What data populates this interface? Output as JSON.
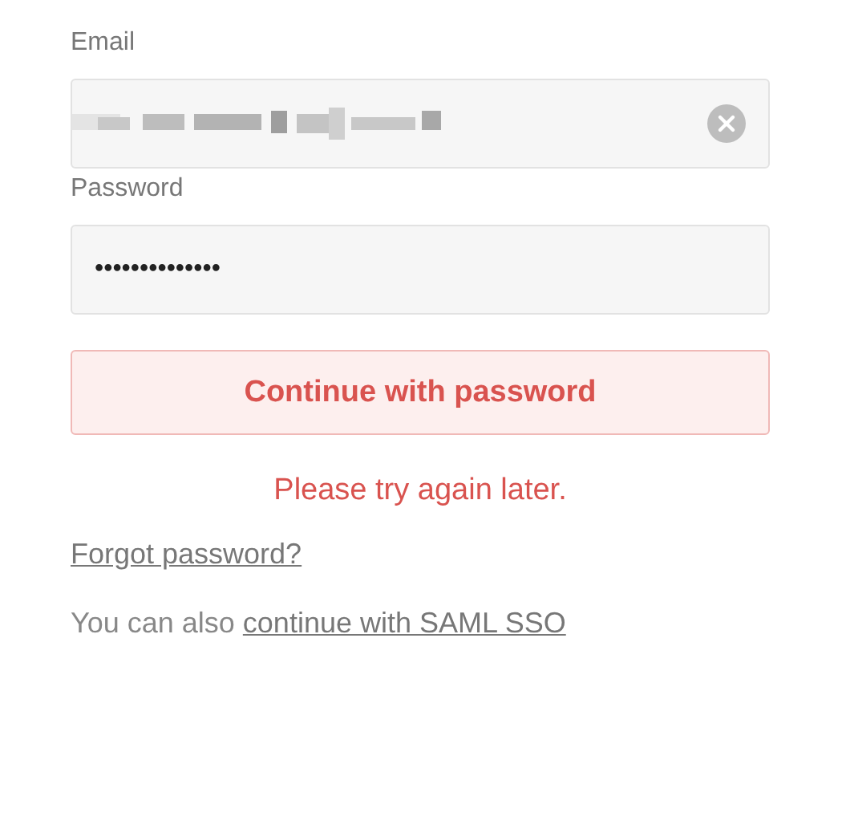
{
  "email": {
    "label": "Email",
    "value_obscured": true,
    "clearable": true
  },
  "password": {
    "label": "Password",
    "value": "••••••••••••••"
  },
  "submit_button": {
    "label": "Continue with password"
  },
  "error": "Please try again later.",
  "forgot_link": "Forgot password?",
  "alternative": {
    "text": "You can also",
    "link": "continue with SAML SSO"
  }
}
